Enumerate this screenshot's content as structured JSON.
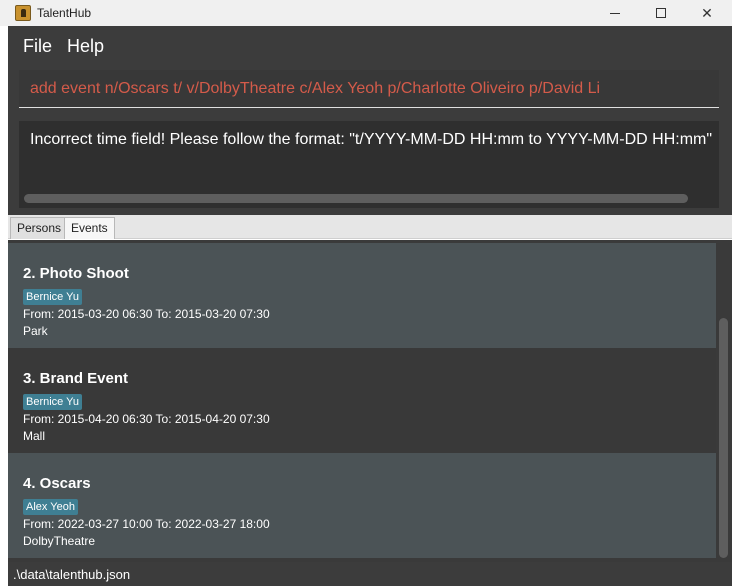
{
  "window": {
    "title": "TalentHub",
    "icon": "app-icon"
  },
  "menu": {
    "file": "File",
    "help": "Help"
  },
  "command": {
    "value": "add event n/Oscars t/ v/DolbyTheatre c/Alex Yeoh p/Charlotte Oliveiro p/David Li"
  },
  "result": {
    "text": "Incorrect time field! Please follow the format: \"t/YYYY-MM-DD HH:mm to YYYY-MM-DD HH:mm\""
  },
  "tabs": [
    {
      "label": "Persons"
    },
    {
      "label": "Events"
    }
  ],
  "events": [
    {
      "title": "2. Photo Shoot",
      "tag": "Bernice Yu",
      "time": "From: 2015-03-20 06:30 To: 2015-03-20 07:30",
      "venue": "Park"
    },
    {
      "title": "3. Brand Event",
      "tag": "Bernice Yu",
      "time": "From: 2015-04-20 06:30 To: 2015-04-20 07:30",
      "venue": "Mall"
    },
    {
      "title": "4. Oscars",
      "tag": "Alex Yeoh",
      "time": "From: 2022-03-27 10:00 To: 2022-03-27 18:00",
      "venue": "DolbyTheatre"
    }
  ],
  "status": {
    "path": ".\\data\\talenthub.json"
  },
  "colors": {
    "command_error": "#d45b4a",
    "tag_bg": "#3f7f93",
    "panel": "#3c3c3c"
  }
}
